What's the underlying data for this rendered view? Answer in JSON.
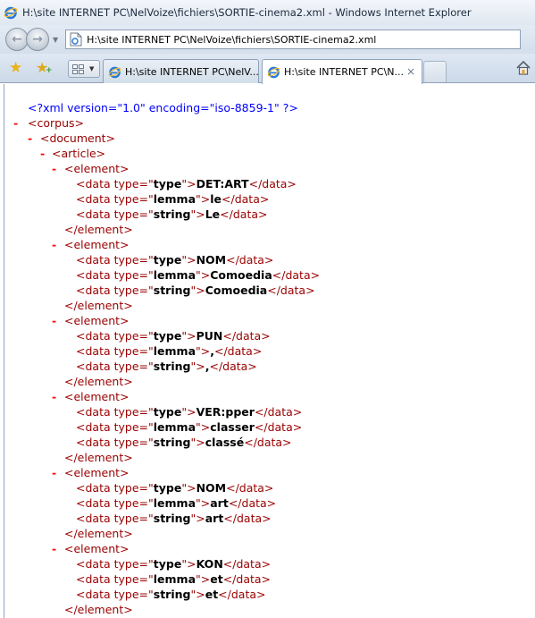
{
  "window": {
    "title": "H:\\site INTERNET PC\\NelVoize\\fichiers\\SORTIE-cinema2.xml - Windows Internet Explorer",
    "address": "H:\\site INTERNET PC\\NelVoize\\fichiers\\SORTIE-cinema2.xml"
  },
  "tabs": [
    {
      "label": "H:\\site INTERNET PC\\NelV...",
      "active": false
    },
    {
      "label": "H:\\site INTERNET PC\\N...",
      "active": true
    }
  ],
  "icons": {
    "back": "arrow-left",
    "forward": "arrow-right",
    "favorites": "star",
    "add_favorites": "star-plus",
    "quick_tabs": "grid",
    "home": "house",
    "close_tab": "×"
  },
  "colors": {
    "xml_declaration": "#0000ff",
    "tag": "#990000",
    "collapse_minus": "#ff0000",
    "content_text": "#000000"
  },
  "xml": {
    "declaration": "<?xml version=\"1.0\" encoding=\"iso-8859-1\" ?>",
    "corpus_open": "<corpus>",
    "document_open": "<document>",
    "article_open": "<article>",
    "element_open": "<element>",
    "element_close": "</element>",
    "minus": "-",
    "elements": [
      {
        "type": "DET:ART",
        "lemma": "le",
        "string": "Le"
      },
      {
        "type": "NOM",
        "lemma": "Comoedia",
        "string": "Comoedia"
      },
      {
        "type": "PUN",
        "lemma": ",",
        "string": ","
      },
      {
        "type": "VER:pper",
        "lemma": "classer",
        "string": "classé"
      },
      {
        "type": "NOM",
        "lemma": "art",
        "string": "art"
      },
      {
        "type": "KON",
        "lemma": "et",
        "string": "et"
      }
    ],
    "data_open_prefix": "<data type=\"",
    "data_open_suffix": "\">",
    "data_close": "</data>",
    "attr_names": {
      "type": "type",
      "lemma": "lemma",
      "string": "string"
    }
  }
}
